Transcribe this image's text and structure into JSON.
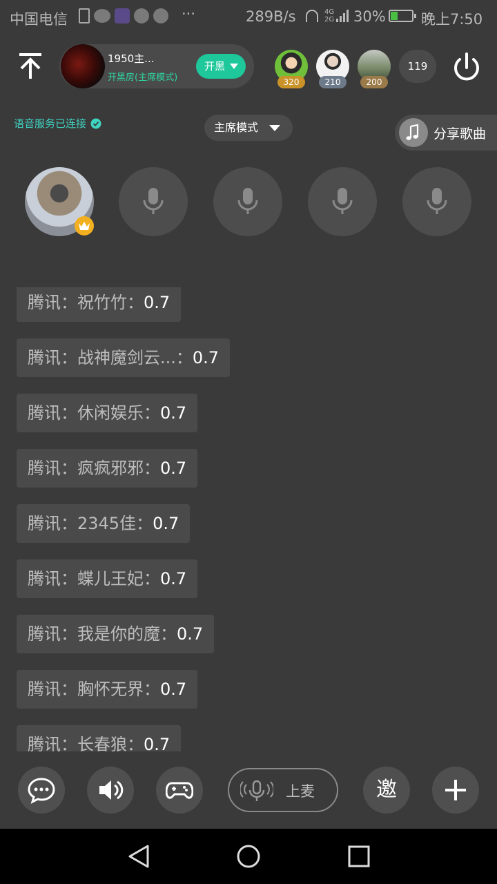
{
  "status_bar": {
    "carrier": "中国电信",
    "more": "···",
    "net_rate": "289B/s",
    "signal_type_top": "4G",
    "signal_type_bottom": "2G",
    "battery_pct": "30%",
    "battery_level": 0.3,
    "time": "晚上7:50"
  },
  "room": {
    "name": "1950主...",
    "mode_status": "开黑房(主席模式)",
    "open_black_label": "开黑",
    "viewers": [
      {
        "score": "320"
      },
      {
        "score": "210"
      },
      {
        "score": "200"
      }
    ],
    "viewer_count": "119"
  },
  "voice_status": "语音服务已连接",
  "mode_select": "主席模式",
  "share_song": "分享歌曲",
  "chat": [
    {
      "source": "腾讯",
      "name": "祝竹竹",
      "value": "0.7"
    },
    {
      "source": "腾讯",
      "name": "战神魔剑云...",
      "value": "0.7"
    },
    {
      "source": "腾讯",
      "name": "休闲娱乐",
      "value": "0.7"
    },
    {
      "source": "腾讯",
      "name": "疯疯邪邪",
      "value": "0.7"
    },
    {
      "source": "腾讯",
      "name": "2345佳",
      "value": "0.7"
    },
    {
      "source": "腾讯",
      "name": "蝶儿王妃",
      "value": "0.7"
    },
    {
      "source": "腾讯",
      "name": "我是你的魔",
      "value": "0.7"
    },
    {
      "source": "腾讯",
      "name": "胸怀无界",
      "value": "0.7"
    },
    {
      "source": "腾讯",
      "name": "长春狼",
      "value": "0.7"
    }
  ],
  "toolbar": {
    "mic_label": "上麦",
    "invite_label": "邀"
  },
  "colors": {
    "background": "#3a3a3a",
    "accent": "#1ec89a",
    "status_ok": "#3fd3c1",
    "crown": "#f2b020"
  }
}
